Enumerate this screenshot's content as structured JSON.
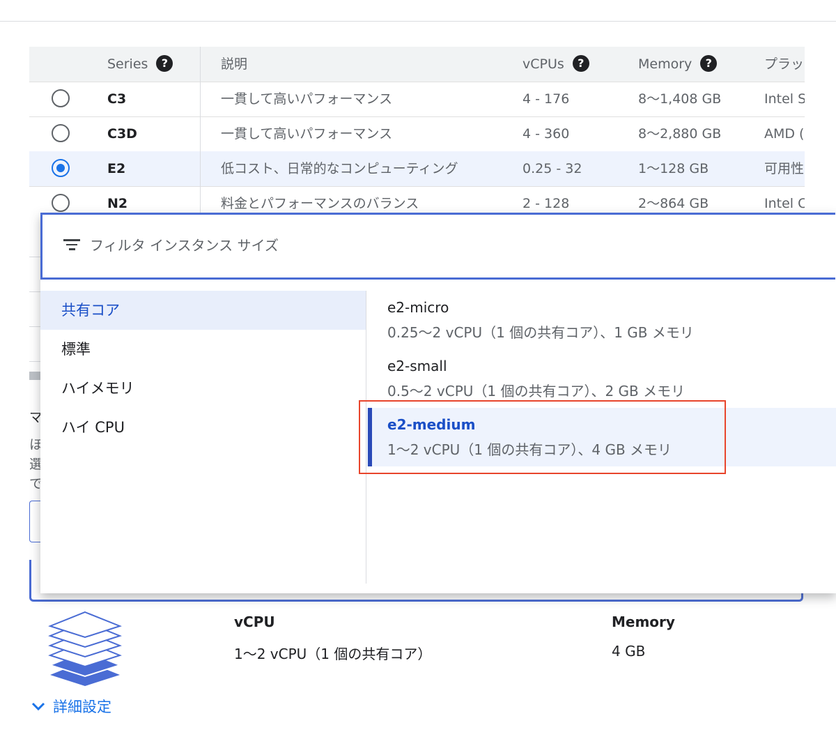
{
  "table": {
    "headers": {
      "series": "Series",
      "description": "説明",
      "vcpus": "vCPUs",
      "memory": "Memory",
      "platform": "プラッ"
    },
    "help_glyph": "?",
    "rows": [
      {
        "series": "C3",
        "description": "一貫して高いパフォーマンス",
        "vcpus": "4 - 176",
        "memory": "8〜1,408 GB",
        "platform": "Intel S",
        "selected": false
      },
      {
        "series": "C3D",
        "description": "一貫して高いパフォーマンス",
        "vcpus": "4 - 360",
        "memory": "8〜2,880 GB",
        "platform": "AMD (",
        "selected": false
      },
      {
        "series": "E2",
        "description": "低コスト、日常的なコンピューティング",
        "vcpus": "0.25 - 32",
        "memory": "1〜128 GB",
        "platform": "可用性",
        "selected": true
      },
      {
        "series": "N2",
        "description": "料金とパフォーマンスのバランス",
        "vcpus": "2 - 128",
        "memory": "2〜864 GB",
        "platform": "Intel C",
        "selected": false
      }
    ]
  },
  "background_fragments": {
    "a": "マ",
    "b": "ほ",
    "c": "選",
    "d": "で"
  },
  "dropdown": {
    "filter_placeholder": "フィルタ インスタンス サイズ",
    "categories": [
      {
        "label": "共有コア",
        "active": true
      },
      {
        "label": "標準",
        "active": false
      },
      {
        "label": "ハイメモリ",
        "active": false
      },
      {
        "label": "ハイ CPU",
        "active": false
      }
    ],
    "options": [
      {
        "name": "e2-micro",
        "desc": "0.25〜2 vCPU（1 個の共有コア）、1 GB メモリ",
        "active": false
      },
      {
        "name": "e2-small",
        "desc": "0.5〜2 vCPU（1 個の共有コア）、2 GB メモリ",
        "active": false
      },
      {
        "name": "e2-medium",
        "desc": "1〜2 vCPU（1 個の共有コア）、4 GB メモリ",
        "active": true
      }
    ]
  },
  "summary": {
    "vcpu_label": "vCPU",
    "vcpu_value": "1〜2 vCPU（1 個の共有コア）",
    "memory_label": "Memory",
    "memory_value": "4 GB"
  },
  "advanced": {
    "label": "詳細設定"
  },
  "colors": {
    "accent": "#1a73e8",
    "selection_border": "#4a6cd4",
    "highlight": "#e8452c",
    "icon_blue": "#4a6cd4"
  }
}
